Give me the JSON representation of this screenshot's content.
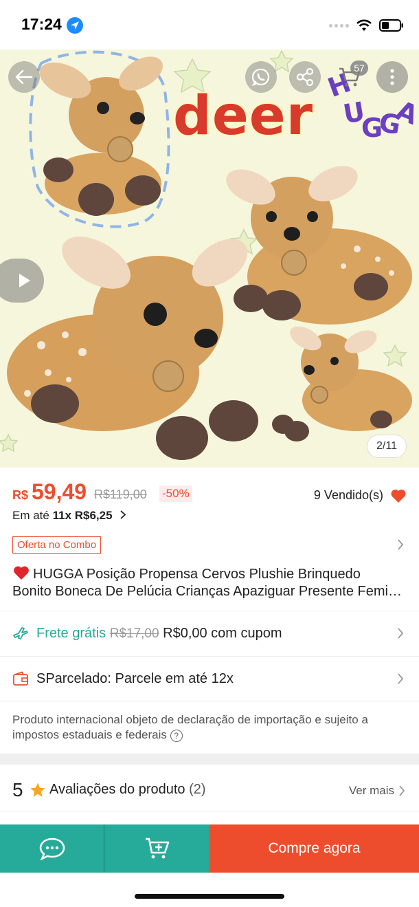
{
  "status_bar": {
    "time": "17:24"
  },
  "hero": {
    "overlay_text": "deer",
    "brand_letters": [
      "H",
      "U",
      "G",
      "G",
      "A"
    ],
    "cart_count": "57",
    "page_indicator": "2/11",
    "icons": [
      "back-arrow-icon",
      "whatsapp-icon",
      "share-icon",
      "cart-icon",
      "more-icon",
      "play-icon"
    ]
  },
  "price": {
    "currency": "R$",
    "current": "59,49",
    "original": "R$119,00",
    "discount": "-50%",
    "sold": "9 Vendido(s)",
    "installment_prefix": "Em até",
    "installment_bold": "11x R$6,25",
    "combo_tag": "Oferta no Combo"
  },
  "product": {
    "title_line1": "HUGGA Posição Propensa Cervos Plushie Brinquedo",
    "title_line2": "Bonito Boneca De Pelúcia Crianças Apaziguar Presente Feminino"
  },
  "shipping": {
    "free_label": "Frete grátis",
    "old_price": "R$17,00",
    "new_price": "R$0,00 com cupom"
  },
  "installments_row": {
    "label": "SParcelado: Parcele em até 12x"
  },
  "import_note": {
    "text": "Produto internacional objeto de declaração de importação e sujeito a impostos estaduais e federais"
  },
  "reviews": {
    "rating": "5",
    "label": "Avaliações do produto",
    "count": "(2)",
    "see_more": "Ver mais"
  },
  "bottom_bar": {
    "buy_label": "Compre agora"
  },
  "colors": {
    "brand_orange": "#ee4d2d",
    "teal": "#26aa99",
    "hero_bg": "#f6f6dc"
  }
}
